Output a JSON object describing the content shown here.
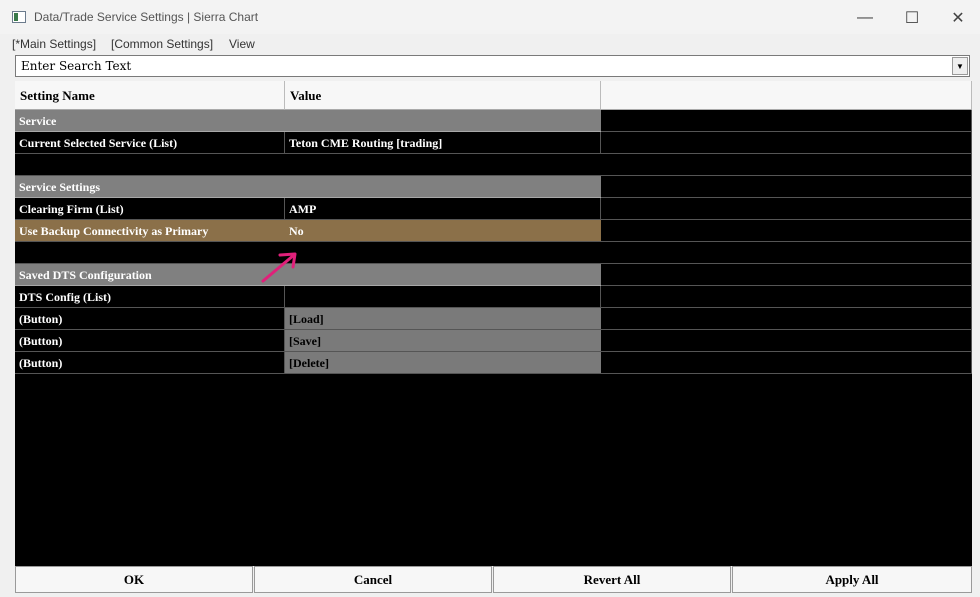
{
  "window": {
    "title": "Data/Trade Service Settings | Sierra Chart",
    "controls": {
      "minimize": "—",
      "maximize": "☐",
      "close": "✕"
    }
  },
  "menu": {
    "items": [
      "[*Main Settings]",
      "[Common Settings]",
      "View"
    ]
  },
  "search": {
    "text": "Enter Search Text",
    "dropdown_glyph": "▼"
  },
  "table": {
    "headers": [
      "Setting Name",
      "Value",
      ""
    ],
    "rows": [
      {
        "type": "section",
        "name": "Service",
        "value": ""
      },
      {
        "type": "item",
        "name": "Current Selected Service (List)",
        "value": "Teton CME Routing    [trading]"
      },
      {
        "type": "blank",
        "name": "",
        "value": ""
      },
      {
        "type": "section",
        "name": "Service Settings",
        "value": ""
      },
      {
        "type": "item",
        "name": "Clearing Firm (List)",
        "value": "AMP"
      },
      {
        "type": "highlight",
        "name": "Use Backup Connectivity as Primary",
        "value": "No"
      },
      {
        "type": "blank",
        "name": "",
        "value": ""
      },
      {
        "type": "section",
        "name": "Saved DTS Configuration",
        "value": ""
      },
      {
        "type": "item",
        "name": "DTS Config (List)",
        "value": ""
      },
      {
        "type": "button",
        "name": " (Button)",
        "value": "[Load]"
      },
      {
        "type": "button",
        "name": " (Button)",
        "value": "[Save]"
      },
      {
        "type": "button",
        "name": " (Button)",
        "value": "[Delete]"
      }
    ]
  },
  "buttons": {
    "ok": "OK",
    "cancel": "Cancel",
    "revert_all": "Revert All",
    "apply_all": "Apply All"
  },
  "colors": {
    "section_bg": "#808080",
    "highlight_bg": "#8b7049",
    "button_value_bg": "#7a7a7a",
    "annotation_arrow": "#e0207a"
  }
}
